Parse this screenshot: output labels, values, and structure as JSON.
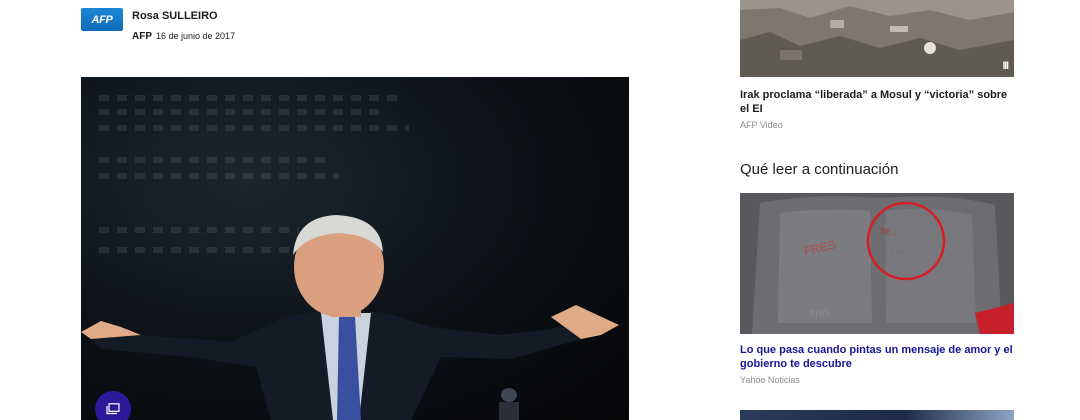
{
  "byline": {
    "logo_text": "AFP",
    "author": "Rosa SULLEIRO",
    "source": "AFP",
    "date": "16 de junio de 2017"
  },
  "main_photo": {
    "description_icon": "gallery-icon",
    "badge_color": "#2d1a9b"
  },
  "rail": {
    "video_card": {
      "title": "Irak proclama “liberada” a Mosul y “victoria” sobre el EI",
      "source": "AFP Video",
      "icon": "video-bars-icon"
    },
    "section_heading": "Qué leer a continuación",
    "next_card": {
      "title": "Lo que pasa cuando pintas un mensaje de amor y el gobierno te descubre",
      "source": "Yahoo Noticias",
      "title_color": "#16159a"
    }
  },
  "colors": {
    "afp_blue": "#1377c9",
    "link_blue": "#16159a",
    "muted": "#8a8a8a"
  }
}
